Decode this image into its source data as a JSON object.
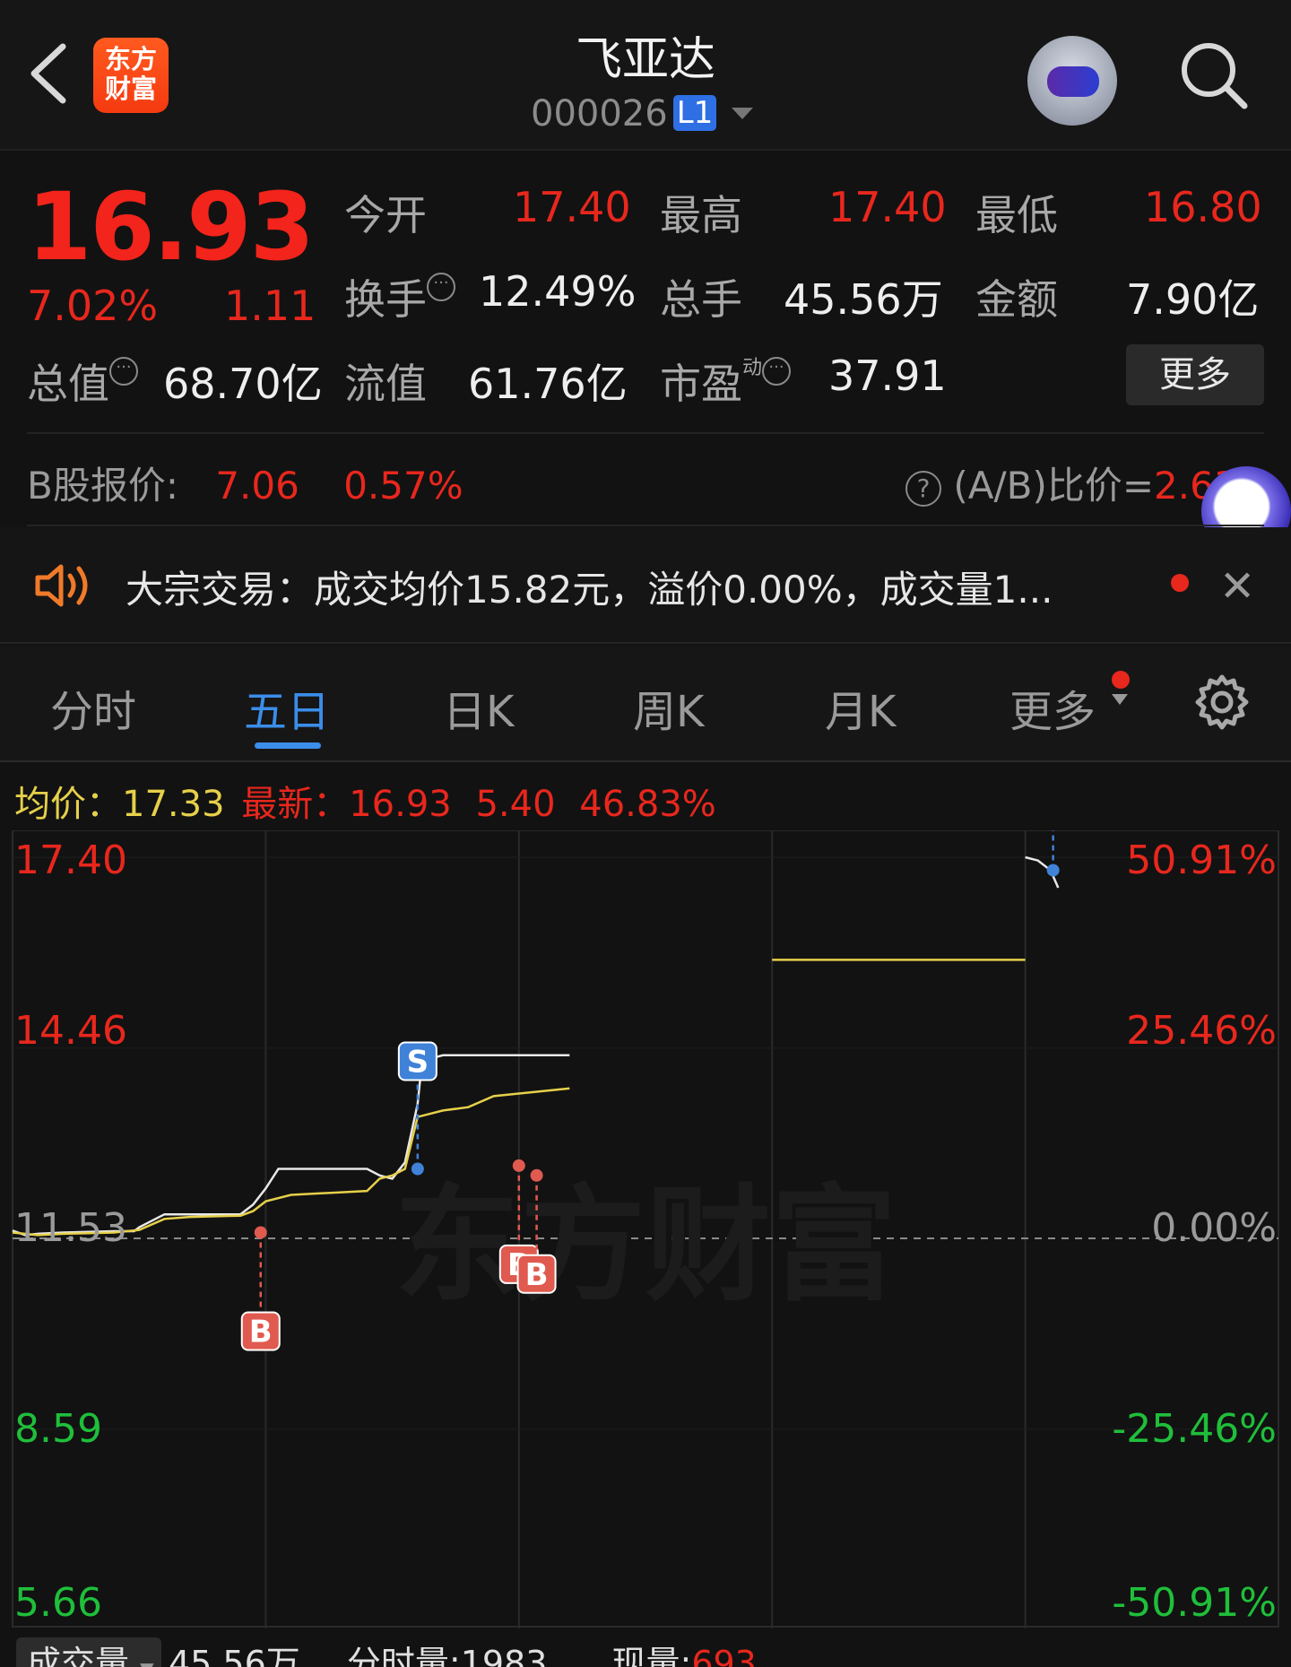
{
  "header": {
    "logo_line1": "东方",
    "logo_line2": "财富",
    "stock_name": "飞亚达",
    "stock_code": "000026",
    "level_badge": "L1"
  },
  "quote": {
    "price": "16.93",
    "change_pct": "7.02%",
    "change": "1.11",
    "open_label": "今开",
    "open": "17.40",
    "high_label": "最高",
    "high": "17.40",
    "low_label": "最低",
    "low": "16.80",
    "turnover_label": "换手",
    "turnover": "12.49%",
    "volume_label": "总手",
    "volume": "45.56万",
    "amount_label": "金额",
    "amount": "7.90亿",
    "mktcap_label": "总值",
    "mktcap": "68.70亿",
    "float_label": "流值",
    "float": "61.76亿",
    "pe_label": "市盈",
    "pe_sup": "动",
    "pe": "37.91",
    "more_button": "更多",
    "bshare_label": "B股报价:",
    "bshare_price": "7.06",
    "bshare_pct": "0.57%",
    "ab_label": "(A/B)比价=",
    "ab_value": "2.63"
  },
  "notice": {
    "text": "大宗交易：成交均价15.82元，溢价0.00%，成交量1..."
  },
  "tabs": [
    "分时",
    "五日",
    "日K",
    "周K",
    "月K",
    "更多"
  ],
  "active_tab": "五日",
  "infoline": {
    "avg_label": "均价：",
    "avg": "17.33",
    "last_label": "最新：",
    "last": "16.93",
    "change": "5.40",
    "pct": "46.83%"
  },
  "chart_data": {
    "type": "line",
    "title": "",
    "y_ticks_left": [
      "17.40",
      "14.46",
      "11.53",
      "8.59",
      "5.66"
    ],
    "y_ticks_right": [
      "50.91%",
      "25.46%",
      "0.00%",
      "-25.46%",
      "-50.91%"
    ],
    "ylim": [
      5.66,
      17.4
    ],
    "baseline": 11.53,
    "days": 5,
    "series": [
      {
        "name": "",
        "color": "#e8e8e8",
        "points": [
          [
            0.0,
            11.65
          ],
          [
            0.05,
            11.58
          ],
          [
            0.1,
            11.6
          ],
          [
            0.2,
            11.62
          ],
          [
            0.3,
            11.63
          ],
          [
            0.4,
            11.64
          ],
          [
            0.48,
            11.64
          ],
          [
            0.5,
            11.7
          ],
          [
            0.6,
            11.9
          ],
          [
            0.7,
            11.9
          ],
          [
            0.8,
            11.9
          ],
          [
            0.9,
            11.9
          ],
          [
            0.95,
            12.05
          ],
          [
            1.0,
            12.3
          ],
          [
            1.05,
            12.6
          ],
          [
            1.1,
            12.6
          ],
          [
            1.2,
            12.6
          ],
          [
            1.3,
            12.6
          ],
          [
            1.4,
            12.6
          ],
          [
            1.45,
            12.5
          ],
          [
            1.5,
            12.45
          ],
          [
            1.55,
            12.7
          ],
          [
            1.6,
            13.6
          ],
          [
            1.62,
            14.35
          ],
          [
            1.65,
            14.3
          ],
          [
            1.7,
            14.35
          ],
          [
            1.8,
            14.35
          ],
          [
            1.9,
            14.35
          ],
          [
            2.0,
            14.35
          ],
          [
            2.1,
            14.35
          ],
          [
            2.2,
            14.35
          ]
        ]
      },
      {
        "name": "",
        "color": "#e6d04a",
        "points": [
          [
            0.0,
            11.62
          ],
          [
            0.1,
            11.58
          ],
          [
            0.2,
            11.6
          ],
          [
            0.3,
            11.61
          ],
          [
            0.4,
            11.62
          ],
          [
            0.5,
            11.66
          ],
          [
            0.6,
            11.83
          ],
          [
            0.7,
            11.86
          ],
          [
            0.8,
            11.87
          ],
          [
            0.9,
            11.88
          ],
          [
            0.95,
            11.95
          ],
          [
            1.0,
            12.1
          ],
          [
            1.1,
            12.2
          ],
          [
            1.2,
            12.22
          ],
          [
            1.3,
            12.24
          ],
          [
            1.4,
            12.26
          ],
          [
            1.45,
            12.45
          ],
          [
            1.5,
            12.5
          ],
          [
            1.55,
            12.6
          ],
          [
            1.6,
            13.4
          ],
          [
            1.7,
            13.5
          ],
          [
            1.8,
            13.55
          ],
          [
            1.9,
            13.72
          ],
          [
            2.0,
            13.76
          ],
          [
            2.1,
            13.8
          ],
          [
            2.2,
            13.84
          ]
        ],
        "day4_flat": 15.82
      },
      {
        "name": "",
        "color": "#e8e8e8",
        "points": [
          [
            4.0,
            17.4
          ],
          [
            4.05,
            17.35
          ],
          [
            4.1,
            17.2
          ],
          [
            4.13,
            16.93
          ]
        ]
      }
    ],
    "markers": [
      {
        "label": "B",
        "price": 11.62,
        "day_pos": 0.98,
        "color": "#e05a4f"
      },
      {
        "label": "S",
        "price": 12.6,
        "day_pos": 1.6,
        "color": "#3f82d8"
      },
      {
        "label": "B",
        "price": 12.65,
        "day_pos": 2.0,
        "color": "#e05a4f"
      },
      {
        "label": "B",
        "price": 12.5,
        "day_pos": 2.07,
        "color": "#e05a4f"
      },
      {
        "label": "S",
        "price": 17.2,
        "day_pos": 4.11,
        "color": "#3f82d8"
      }
    ],
    "watermark": "东方财富"
  },
  "bottombar": {
    "vol_button": "成交量",
    "total": "45.56万",
    "minute_label": "分时量:1983",
    "now_label": "现量:",
    "now": "693"
  }
}
